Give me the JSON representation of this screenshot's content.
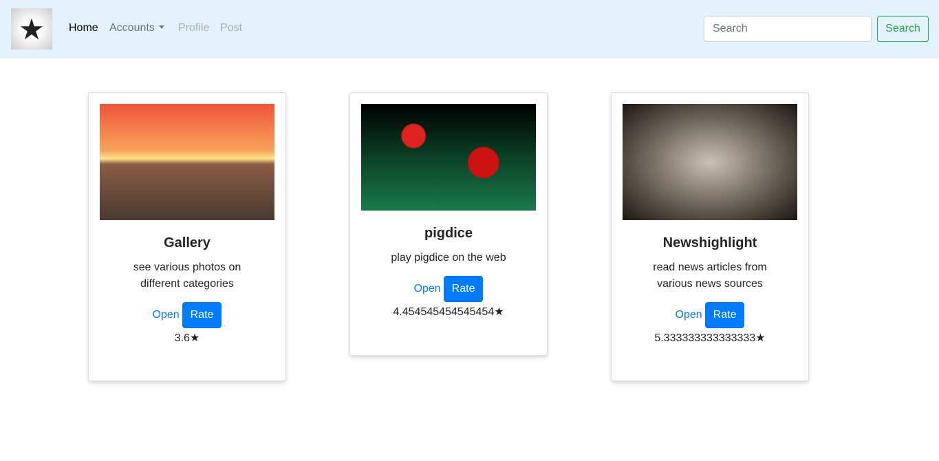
{
  "nav": {
    "home": "Home",
    "accounts": "Accounts",
    "profile": "Profile",
    "post": "Post",
    "search_placeholder": "Search",
    "search_button": "Search"
  },
  "cards": [
    {
      "title": "Gallery",
      "description": "see various photos on different categories",
      "open": "Open",
      "rate": "Rate",
      "rating": "3.6★"
    },
    {
      "title": "pigdice",
      "description": "play pigdice on the web",
      "open": "Open",
      "rate": "Rate",
      "rating": "4.454545454545454★"
    },
    {
      "title": "Newshighlight",
      "description": "read news articles from various news sources",
      "open": "Open",
      "rate": "Rate",
      "rating": "5.333333333333333★"
    }
  ],
  "colors": {
    "navbar": "#e3f2fd",
    "primary": "#007bff",
    "success": "#28a745"
  }
}
